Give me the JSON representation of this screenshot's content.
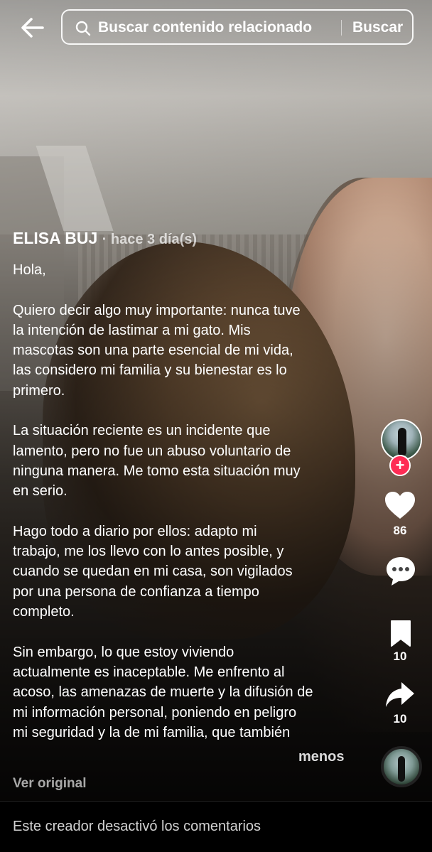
{
  "search": {
    "placeholder": "Buscar contenido relacionado",
    "button_label": "Buscar"
  },
  "post": {
    "author": "ELISA BUJ",
    "time": "· hace 3 día(s)",
    "caption": "Hola,\n\nQuiero decir algo muy importante: nunca tuve\nla intención de lastimar a mi gato. Mis\nmascotas son una parte esencial de mi vida,\nlas considero mi familia y su bienestar es lo\nprimero.\n\nLa situación reciente es un incidente que\nlamento, pero no fue un abuso voluntario de\nninguna manera. Me tomo esta situación muy\nen serio.\n\nHago todo a diario por ellos: adapto mi\ntrabajo, me los llevo con lo antes posible, y\ncuando se quedan en mi casa, son vigilados\npor una persona de confianza a tiempo\ncompleto.\n\nSin embargo, lo que estoy viviendo\nactualmente es inaceptable. Me enfrento al\nacoso, las amenazas de muerte y la difusión de\nmi información personal, poniendo en peligro\nmi seguridad y la de mi familia, que también",
    "less_label": "menos",
    "view_original_label": "Ver original"
  },
  "actions": {
    "likes": "86",
    "saves": "10",
    "shares": "10"
  },
  "icons": {
    "back": "arrow-left-icon",
    "search": "search-icon",
    "like": "heart-icon",
    "comment": "comment-bubble-icon",
    "save": "bookmark-icon",
    "share": "share-arrow-icon",
    "follow": "plus-icon"
  },
  "colors": {
    "follow_accent": "#fe2c55"
  },
  "footer": {
    "comments_disabled": "Este creador desactivó los comentarios"
  }
}
